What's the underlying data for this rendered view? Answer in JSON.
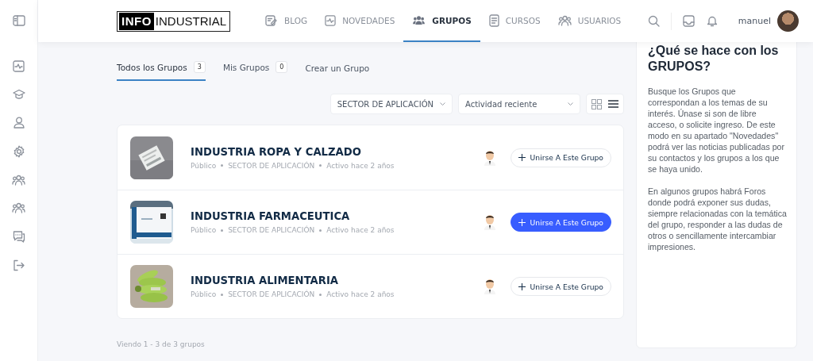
{
  "header": {
    "logo": {
      "boxed": "INFO",
      "plain": "INDUSTRIAL"
    },
    "nav": [
      {
        "label": "BLOG",
        "selected": false
      },
      {
        "label": "NOVEDADES",
        "selected": false
      },
      {
        "label": "GRUPOS",
        "selected": true
      },
      {
        "label": "CURSOS",
        "selected": false
      },
      {
        "label": "USUARIOS",
        "selected": false
      }
    ],
    "user": "manuel"
  },
  "tabs": [
    {
      "label": "Todos los Grupos",
      "count": "3",
      "selected": true
    },
    {
      "label": "Mis Grupos",
      "count": "0",
      "selected": false
    },
    {
      "label": "Crear un Grupo",
      "selected": false
    }
  ],
  "filters": [
    {
      "value": "SECTOR DE APLICACIÓN"
    },
    {
      "value": "Actividad reciente"
    }
  ],
  "views": [
    {
      "kind": "grid",
      "selected": false
    },
    {
      "kind": "list",
      "selected": true
    }
  ],
  "groups": [
    {
      "title": "INDUSTRIA ROPA Y CALZADO",
      "meta": [
        "Público",
        "SECTOR DE APLICACIÓN",
        "Activo hace 2 años"
      ],
      "button": "Unirse A Este Grupo",
      "hovered": false
    },
    {
      "title": "INDUSTRIA FARMACEUTICA",
      "meta": [
        "Público",
        "SECTOR DE APLICACIÓN",
        "Activo hace 2 años"
      ],
      "button": "Unirse A Este Grupo",
      "hovered": true
    },
    {
      "title": "INDUSTRIA ALIMENTARIA",
      "meta": [
        "Público",
        "SECTOR DE APLICACIÓN",
        "Activo hace 2 años"
      ],
      "button": "Unirse A Este Grupo",
      "hovered": false
    }
  ],
  "footer": "Viendo 1 - 3 de 3 grupos",
  "widget": {
    "title": "¿Qué se hace con los GRUPOS?",
    "paragraphs": [
      "Busque los Grupos que correspondan a los temas de su interés. Únase si son de libre acceso, o solicite ingreso. De este modo en su apartado \"Novedades\" podrá ver las noticias publicadas por su contactos y los grupos a los que se haya unido.",
      "En algunos grupos habrá Foros donde podrá exponer sus dudas, siempre relacionadas con la temática del grupo, responder a las dudas de otros o sencillamente intercambiar impresiones."
    ]
  }
}
